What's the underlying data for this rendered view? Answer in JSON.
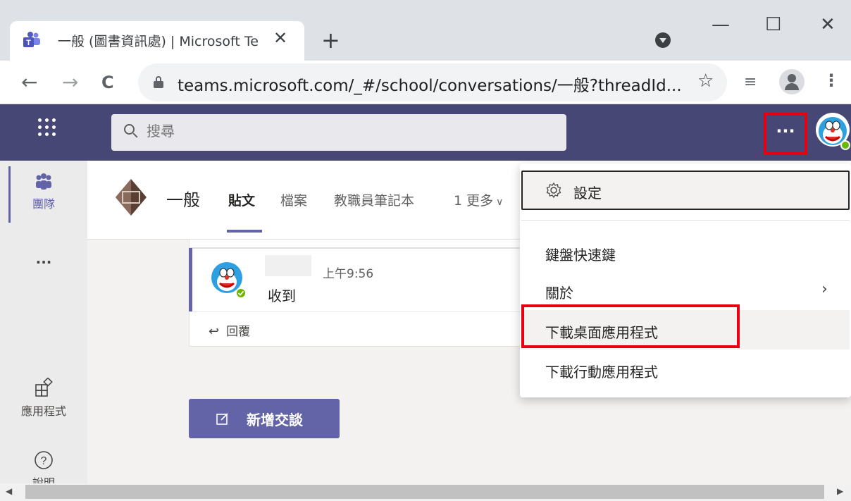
{
  "browser": {
    "tab_title": "一般 (圖書資訊處) | Microsoft Te",
    "tab_close": "✕",
    "new_tab": "+",
    "window_min": "—",
    "window_max": "☐",
    "window_close": "✕",
    "back": "←",
    "forward": "→",
    "reload": "C",
    "url": "teams.microsoft.com/_#/school/conversations/一般?threadId...",
    "bookmark_star": "☆",
    "menu_dots": "⋮",
    "reading_list": "≡"
  },
  "teams": {
    "search_placeholder": "搜尋",
    "more_button": "···",
    "rail": {
      "teams_label": "團隊",
      "more": "···",
      "apps_label": "應用程式",
      "help_label": "說明"
    },
    "channel": {
      "title": "一般",
      "tabs": [
        "貼文",
        "檔案",
        "教職員筆記本",
        "1 更多"
      ]
    },
    "message": {
      "time": "上午9:56",
      "text": "收到",
      "reply": "回覆"
    },
    "new_conversation": "新增交談",
    "menu": {
      "settings": "設定",
      "keyboard_shortcuts": "鍵盤快速鍵",
      "about": "關於",
      "download_desktop": "下載桌面應用程式",
      "download_mobile": "下載行動應用程式"
    }
  },
  "colors": {
    "teams_purple": "#464775",
    "accent": "#6264a7",
    "highlight_red": "#e60012"
  }
}
